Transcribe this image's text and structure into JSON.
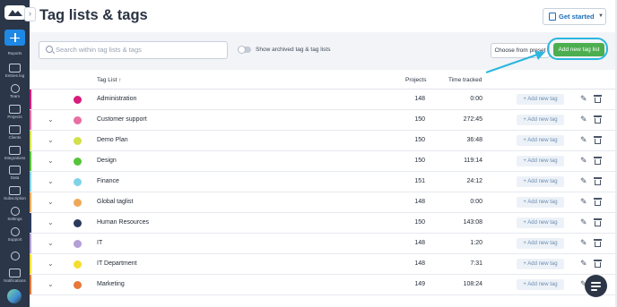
{
  "page": {
    "title": "Tag lists & tags",
    "get_started": "Get started"
  },
  "sidebar": {
    "items": [
      {
        "label": "Reports"
      },
      {
        "label": "Entries log"
      },
      {
        "label": "Team"
      },
      {
        "label": "Projects"
      },
      {
        "label": "Clients"
      },
      {
        "label": "Integrations"
      },
      {
        "label": "Data"
      },
      {
        "label": "Subscription"
      },
      {
        "label": "Settings"
      },
      {
        "label": "Support"
      },
      {
        "label": "Notifications"
      }
    ]
  },
  "toolbar": {
    "search_placeholder": "Search within tag lists & tags",
    "archived_toggle_label": "Show archived tag & tag lists",
    "choose_preset": "Choose from preset",
    "add_new_tag_list": "Add new tag list"
  },
  "table": {
    "headers": {
      "tag_list": "Tag List ↑",
      "projects": "Projects",
      "time_tracked": "Time tracked"
    },
    "add_tag_label": "+ Add new tag",
    "rows": [
      {
        "name": "Administration",
        "projects": "148",
        "time": "0:00",
        "color": "#d81b7d",
        "stripe": "#d81b7d",
        "expandable": false
      },
      {
        "name": "Customer support",
        "projects": "150",
        "time": "272:45",
        "color": "#e86ea3",
        "stripe": "#e86ea3",
        "expandable": true
      },
      {
        "name": "Demo Plan",
        "projects": "150",
        "time": "36:48",
        "color": "#d2e04a",
        "stripe": "#d2e04a",
        "expandable": true
      },
      {
        "name": "Design",
        "projects": "150",
        "time": "119:14",
        "color": "#55c43b",
        "stripe": "#55c43b",
        "expandable": true
      },
      {
        "name": "Finance",
        "projects": "151",
        "time": "24:12",
        "color": "#7fd3e8",
        "stripe": "#7fd3e8",
        "expandable": true
      },
      {
        "name": "Global taglist",
        "projects": "148",
        "time": "0:00",
        "color": "#f0a858",
        "stripe": "#f0a858",
        "expandable": true
      },
      {
        "name": "Human Resources",
        "projects": "150",
        "time": "143:08",
        "color": "#2c3a5e",
        "stripe": "#2c3a5e",
        "expandable": true
      },
      {
        "name": "IT",
        "projects": "148",
        "time": "1:20",
        "color": "#b49fd6",
        "stripe": "#b49fd6",
        "expandable": true
      },
      {
        "name": "IT Department",
        "projects": "148",
        "time": "7:31",
        "color": "#f5dd2f",
        "stripe": "#f5dd2f",
        "expandable": true
      },
      {
        "name": "Marketing",
        "projects": "149",
        "time": "108:24",
        "color": "#e8773a",
        "stripe": "#e8773a",
        "expandable": true
      }
    ]
  },
  "colors": {
    "sidebar_bg": "#2b3648",
    "accent_blue": "#1e88e5",
    "add_button_green": "#4cae4f",
    "highlight_cyan": "#2cb6de"
  }
}
